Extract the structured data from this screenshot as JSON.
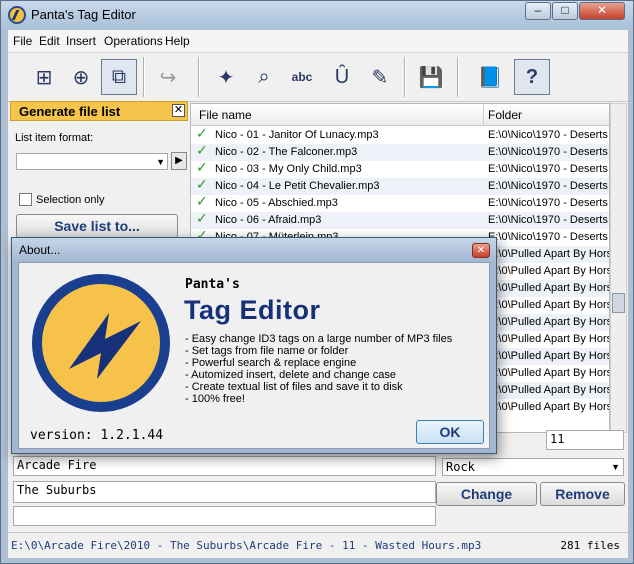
{
  "window": {
    "title": "Panta's Tag Editor",
    "min": "–",
    "max": "□",
    "close": "✕"
  },
  "menu": [
    "File",
    "Edit",
    "Insert",
    "Operations",
    "Help"
  ],
  "toolbar_icons": [
    "new-tag-icon",
    "add-tag-icon",
    "add-multi-icon",
    "refresh-icon",
    "magic-wand-icon",
    "search-replace-icon",
    "abc-icon",
    "case-icon",
    "script-icon",
    "save-disk-icon",
    "book-icon",
    "help-icon"
  ],
  "left_panel": {
    "title": "Generate file list",
    "close": "✕",
    "format_label": "List item format:",
    "selection_only": "Selection only",
    "save_button": "Save list to..."
  },
  "file_list": {
    "columns": [
      "File name",
      "Folder"
    ],
    "rows": [
      {
        "name": "Nico - 01 - Janitor Of Lunacy.mp3",
        "folder": "E:\\0\\Nico\\1970 - Deserts"
      },
      {
        "name": "Nico - 02 - The Falconer.mp3",
        "folder": "E:\\0\\Nico\\1970 - Deserts"
      },
      {
        "name": "Nico - 03 - My Only Child.mp3",
        "folder": "E:\\0\\Nico\\1970 - Deserts"
      },
      {
        "name": "Nico - 04 - Le Petit Chevalier.mp3",
        "folder": "E:\\0\\Nico\\1970 - Deserts"
      },
      {
        "name": "Nico - 05 - Abschied.mp3",
        "folder": "E:\\0\\Nico\\1970 - Deserts"
      },
      {
        "name": "Nico - 06 - Afraid.mp3",
        "folder": "E:\\0\\Nico\\1970 - Deserts"
      },
      {
        "name": "Nico - 07 - Müterlein.mp3",
        "folder": "E:\\0\\Nico\\1970 - Deserts"
      },
      {
        "name": "",
        "folder": "E:\\0\\Pulled Apart By Hors"
      },
      {
        "name": "",
        "folder": "E:\\0\\Pulled Apart By Hors"
      },
      {
        "name": "",
        "folder": "E:\\0\\Pulled Apart By Hors"
      },
      {
        "name": "",
        "folder": "E:\\0\\Pulled Apart By Hors"
      },
      {
        "name": "",
        "folder": "E:\\0\\Pulled Apart By Hors"
      },
      {
        "name": "",
        "folder": "E:\\0\\Pulled Apart By Hors"
      },
      {
        "name": "",
        "folder": "E:\\0\\Pulled Apart By Hors"
      },
      {
        "name": "",
        "folder": "E:\\0\\Pulled Apart By Hors"
      },
      {
        "name": "",
        "folder": "E:\\0\\Pulled Apart By Hors"
      },
      {
        "name": "",
        "folder": "E:\\0\\Pulled Apart By Hors"
      }
    ]
  },
  "editor": {
    "track": "11",
    "artist": "Arcade Fire",
    "album": "The Suburbs",
    "comment": "",
    "genre": "Rock",
    "change_button": "Change",
    "remove_button": "Remove"
  },
  "status": {
    "path": "E:\\0\\Arcade Fire\\2010 - The Suburbs\\Arcade Fire - 11 - Wasted Hours.mp3",
    "count": "281 files"
  },
  "about": {
    "title": "About...",
    "close": "✕",
    "brand_small": "Panta's",
    "brand_big": "Tag Editor",
    "features": [
      "- Easy change ID3 tags on a large number of MP3 files",
      "- Set tags from file name or folder",
      "- Powerful search & replace engine",
      "- Automized insert, delete and change case",
      "- Create textual list of files and save it to disk",
      "- 100% free!"
    ],
    "version": "version: 1.2.1.44",
    "ok": "OK"
  },
  "colors": {
    "accent_yellow": "#f5c54b",
    "brand_blue": "#16307a",
    "check_green": "#2a9a2a"
  }
}
